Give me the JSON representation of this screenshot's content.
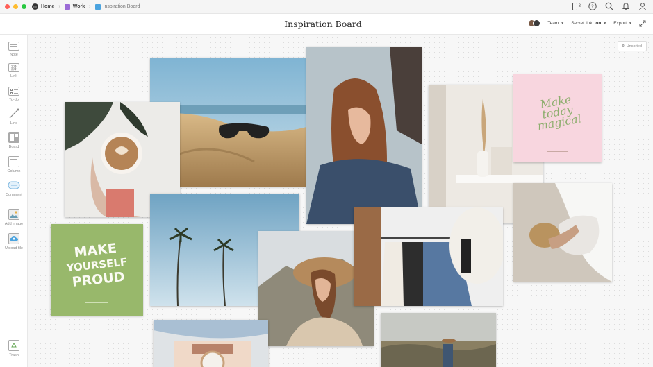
{
  "breadcrumb": {
    "home": "Home",
    "work": "Work",
    "current": "Inspiration Board"
  },
  "topbar": {
    "device_count": "3"
  },
  "board": {
    "title": "Inspiration Board"
  },
  "header_actions": {
    "team": "Team",
    "secret_link_label": "Secret link:",
    "secret_link_value": "on",
    "export": "Export"
  },
  "sidebar": {
    "tools": [
      {
        "label": "Note"
      },
      {
        "label": "Link"
      },
      {
        "label": "To-do"
      },
      {
        "label": "Line"
      },
      {
        "label": "Board"
      },
      {
        "label": "Column"
      },
      {
        "label": "Comment"
      },
      {
        "label": "Add image"
      },
      {
        "label": "Upload file"
      }
    ],
    "trash": "Trash"
  },
  "canvas": {
    "unsorted_count": "0",
    "unsorted_label": "Unsorted"
  },
  "cards": {
    "magical": {
      "line1": "Make",
      "line2": "today",
      "line3": "magical"
    },
    "proud": {
      "line1": "MAKE",
      "line2": "YOURSELF",
      "line3": "PROUD"
    }
  },
  "colors": {
    "accent_purple": "#9b6bd6",
    "accent_blue": "#4aa3df",
    "green_card": "#98b86b",
    "pink_card": "#f8d6df"
  }
}
